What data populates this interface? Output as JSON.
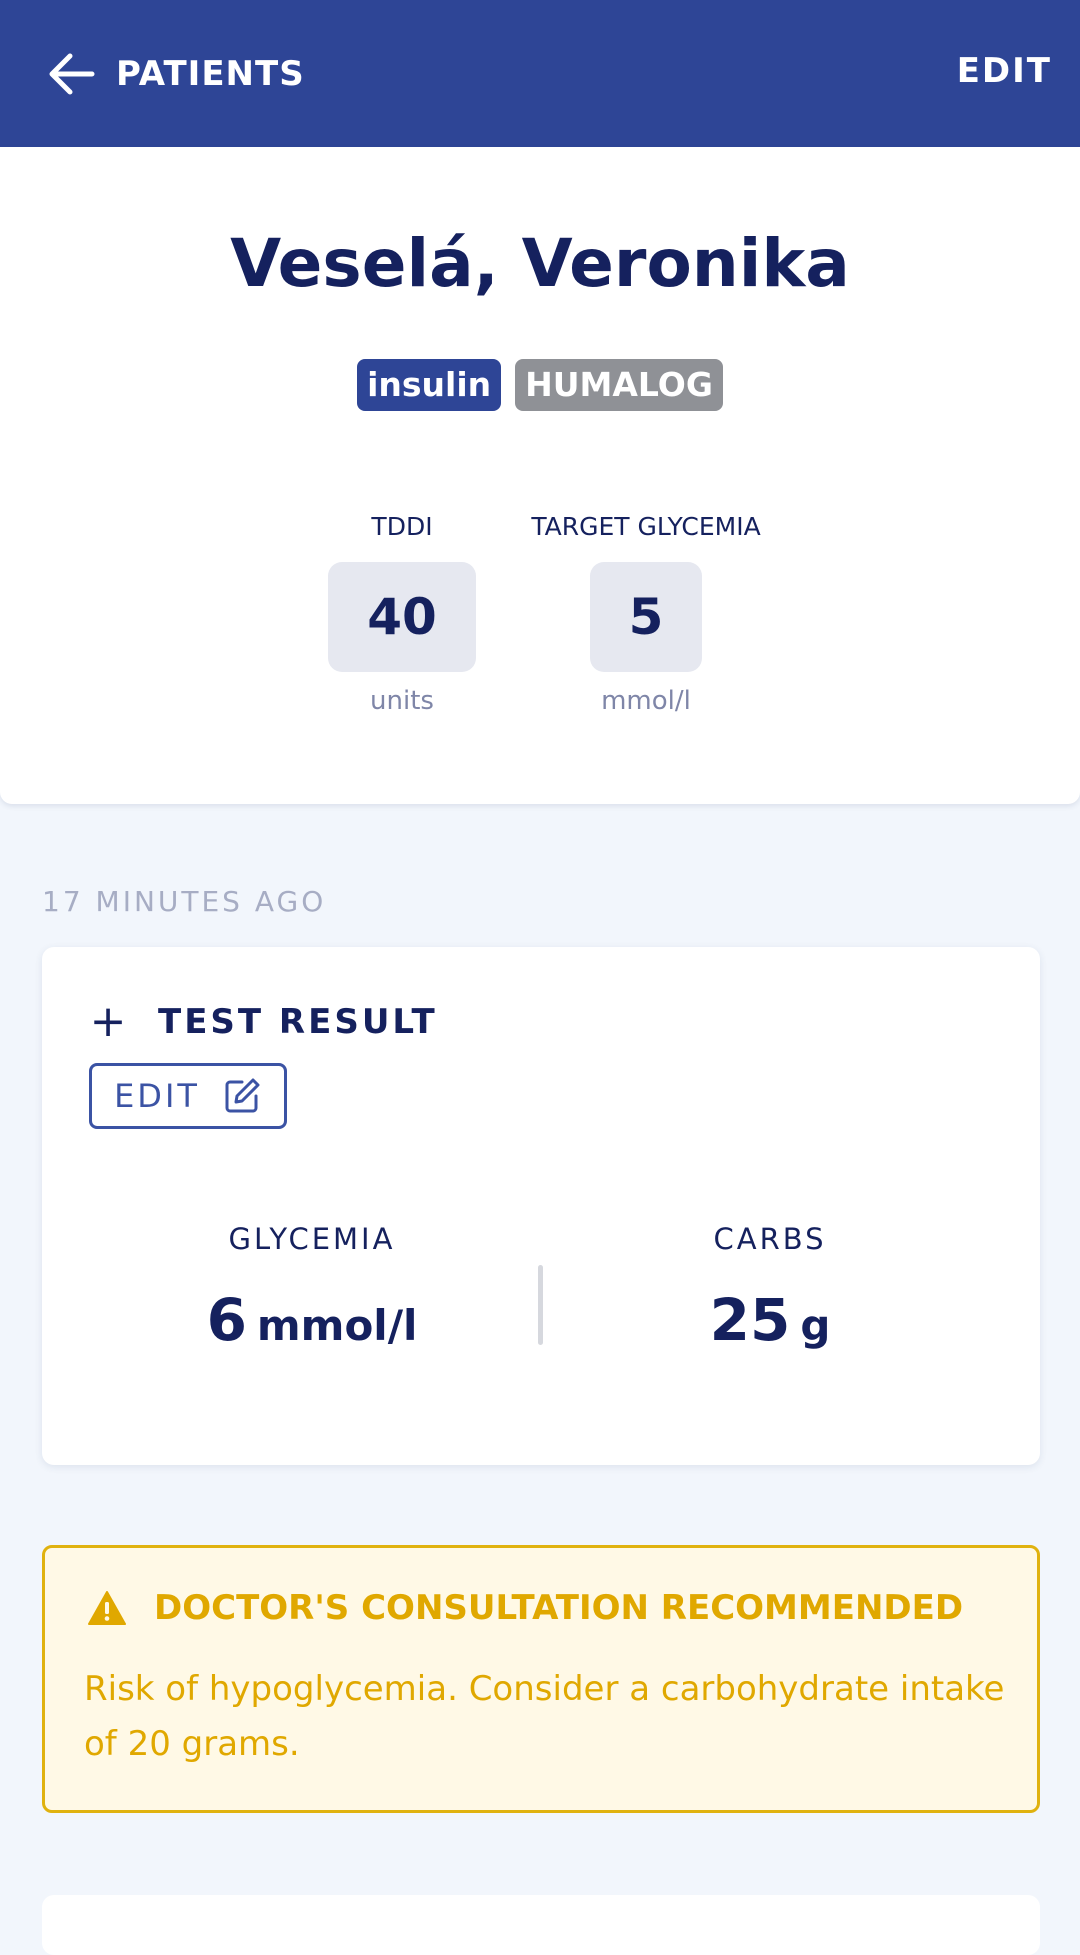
{
  "header": {
    "back_label": "PATIENTS",
    "edit_label": "EDIT"
  },
  "patient": {
    "name": "Veselá, Veronika",
    "badges": [
      {
        "label": "insulin",
        "color": "#2e4596"
      },
      {
        "label": "HUMALOG",
        "color": "#8f9196"
      }
    ],
    "metrics": [
      {
        "label": "TDDI",
        "value": "40",
        "unit": "units"
      },
      {
        "label": "TARGET GLYCEMIA",
        "value": "5",
        "unit": "mmol/l"
      }
    ]
  },
  "entry": {
    "timestamp": "17 MINUTES AGO",
    "title": "TEST RESULT",
    "edit_label": "EDIT",
    "readings": [
      {
        "label": "GLYCEMIA",
        "value": "6",
        "unit": "mmol/l"
      },
      {
        "label": "CARBS",
        "value": "25",
        "unit": "g"
      }
    ]
  },
  "alert": {
    "title": "DOCTOR'S CONSULTATION RECOMMENDED",
    "message": "Risk of hypoglycemia. Consider a carbohydrate intake of 20 grams.",
    "color": "#e0a800"
  },
  "icons": {
    "back": "arrow-left-icon",
    "add": "plus-icon",
    "edit": "edit-square-icon",
    "warning": "warning-triangle-icon"
  }
}
